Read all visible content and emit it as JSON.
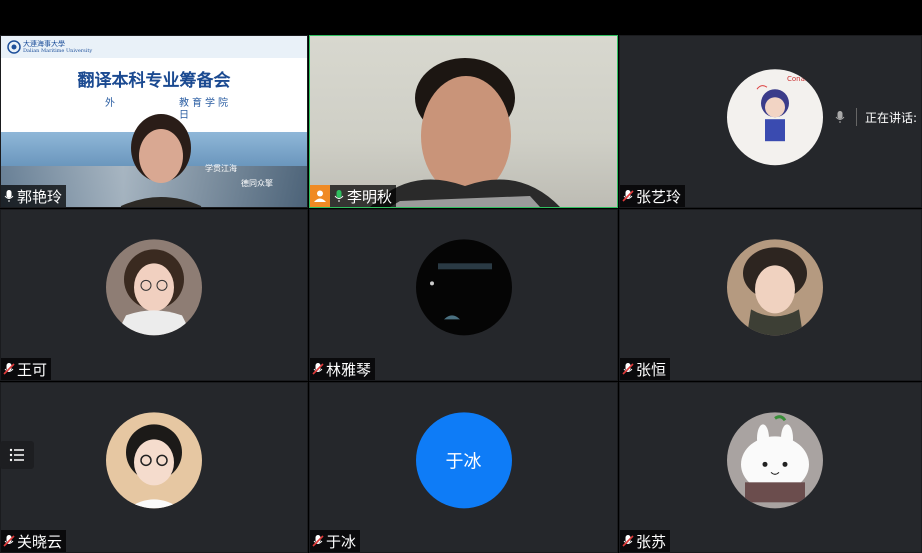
{
  "participants": [
    {
      "name": "郭艳玲",
      "mic": "on"
    },
    {
      "name": "李明秋",
      "mic": "on",
      "host": true
    },
    {
      "name": "张艺玲",
      "mic": "muted"
    },
    {
      "name": "王可",
      "mic": "muted"
    },
    {
      "name": "林雅琴",
      "mic": "muted"
    },
    {
      "name": "张恒",
      "mic": "muted"
    },
    {
      "name": "关晓云",
      "mic": "muted"
    },
    {
      "name": "于冰",
      "mic": "muted",
      "avatar_text": "于冰"
    },
    {
      "name": "张苏",
      "mic": "muted"
    }
  ],
  "slide": {
    "university": "大連海事大學",
    "university_en": "Dalian Maritime University",
    "title": "翻译本科专业筹备会",
    "subtitle_left": "外",
    "subtitle_right": "教育学院",
    "date_fragment": "日",
    "script_1": "学贯江海",
    "script_2": "德同众擎"
  },
  "speaking": {
    "label": "正在讲话:"
  },
  "colors": {
    "active_border": "#2fbf5f",
    "avatar_blue": "#0e7cf7",
    "tile_bg": "#25272b",
    "host_badge": "#f08a24"
  },
  "icons": {
    "mic": "mic-icon",
    "mic_muted": "mic-muted-icon",
    "host": "host-icon",
    "menu": "list-menu-icon"
  }
}
